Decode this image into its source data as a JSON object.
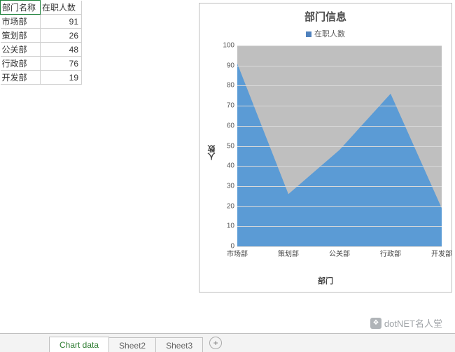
{
  "table": {
    "headers": [
      "部门名称",
      "在职人数"
    ],
    "rows": [
      {
        "dept": "市场部",
        "count": 91
      },
      {
        "dept": "策划部",
        "count": 26
      },
      {
        "dept": "公关部",
        "count": 48
      },
      {
        "dept": "行政部",
        "count": 76
      },
      {
        "dept": "开发部",
        "count": 19
      }
    ]
  },
  "chart_data": {
    "type": "area",
    "title": "部门信息",
    "legend": "在职人数",
    "xlabel": "部门",
    "ylabel": "人数",
    "categories": [
      "市场部",
      "策划部",
      "公关部",
      "行政部",
      "开发部"
    ],
    "values": [
      91,
      26,
      48,
      76,
      19
    ],
    "ylim": [
      0,
      100
    ],
    "yticks": [
      0,
      10,
      20,
      30,
      40,
      50,
      60,
      70,
      80,
      90,
      100
    ],
    "fill_color": "#5b9bd5",
    "plot_bg": "#bfbfbf"
  },
  "tabs": {
    "items": [
      "Chart data",
      "Sheet2",
      "Sheet3"
    ],
    "active_index": 0
  },
  "watermark": {
    "text": "dotNET名人堂"
  }
}
